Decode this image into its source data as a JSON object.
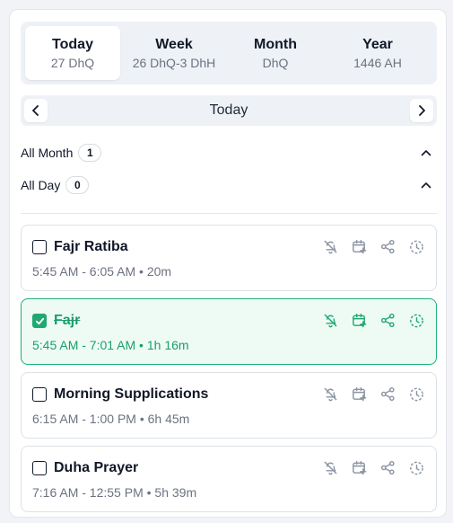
{
  "colors": {
    "accent": "#1fa971",
    "muted": "#8a94a3"
  },
  "tabs": [
    {
      "label": "Today",
      "sub": "27 DhQ"
    },
    {
      "label": "Week",
      "sub": "26 DhQ-3 DhH"
    },
    {
      "label": "Month",
      "sub": "DhQ"
    },
    {
      "label": "Year",
      "sub": "1446 AH"
    }
  ],
  "nav": {
    "title": "Today",
    "prev_icon": "chevron-left-icon",
    "next_icon": "chevron-right-icon"
  },
  "sections": {
    "all_month": {
      "label": "All Month",
      "count": "1"
    },
    "all_day": {
      "label": "All Day",
      "count": "0"
    }
  },
  "events": [
    {
      "title": "Fajr Ratiba",
      "time": "5:45 AM - 6:05 AM",
      "duration": "20m",
      "done": false
    },
    {
      "title": "Fajr",
      "time": "5:45 AM - 7:01 AM",
      "duration": "1h 16m",
      "done": true
    },
    {
      "title": "Morning Supplications",
      "time": "6:15 AM - 1:00 PM",
      "duration": "6h 45m",
      "done": false
    },
    {
      "title": "Duha Prayer",
      "time": "7:16 AM - 12:55 PM",
      "duration": "5h 39m",
      "done": false
    }
  ],
  "event_actions": [
    "bell-off-icon",
    "add-to-calendar-icon",
    "share-icon",
    "timer-icon"
  ]
}
